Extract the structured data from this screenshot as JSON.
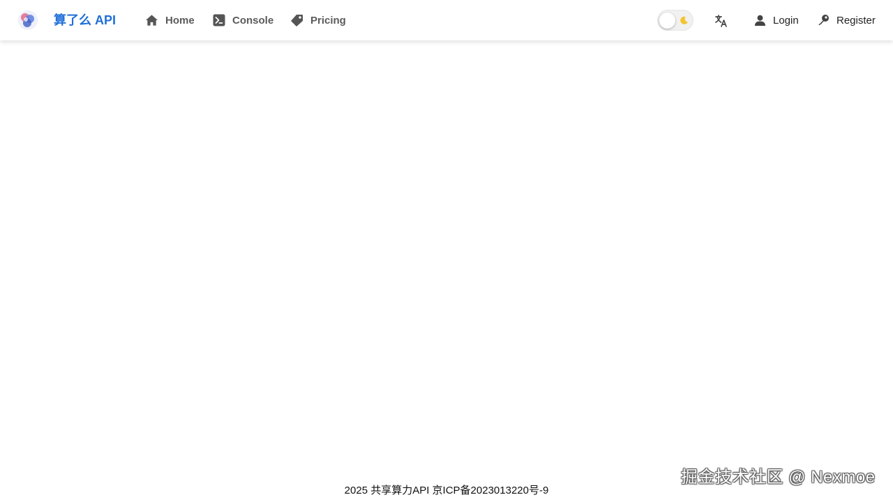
{
  "header": {
    "brand": "算了么 API",
    "nav": {
      "home": "Home",
      "console": "Console",
      "pricing": "Pricing"
    },
    "auth": {
      "login": "Login",
      "register": "Register"
    }
  },
  "footer": {
    "text": "2025 共享算力API 京ICP备2023013220号-9"
  },
  "watermark": {
    "text": "掘金技术社区 @ Nexmoe"
  },
  "colors": {
    "brand": "#1f6fd9",
    "nav_text": "#5b5b5b",
    "icon": "#555555"
  },
  "icons": {
    "home": "home-icon",
    "console": "terminal-icon",
    "pricing": "tag-icon",
    "theme": "moon-icon",
    "language": "translate-icon",
    "login": "user-icon",
    "register": "key-icon"
  }
}
